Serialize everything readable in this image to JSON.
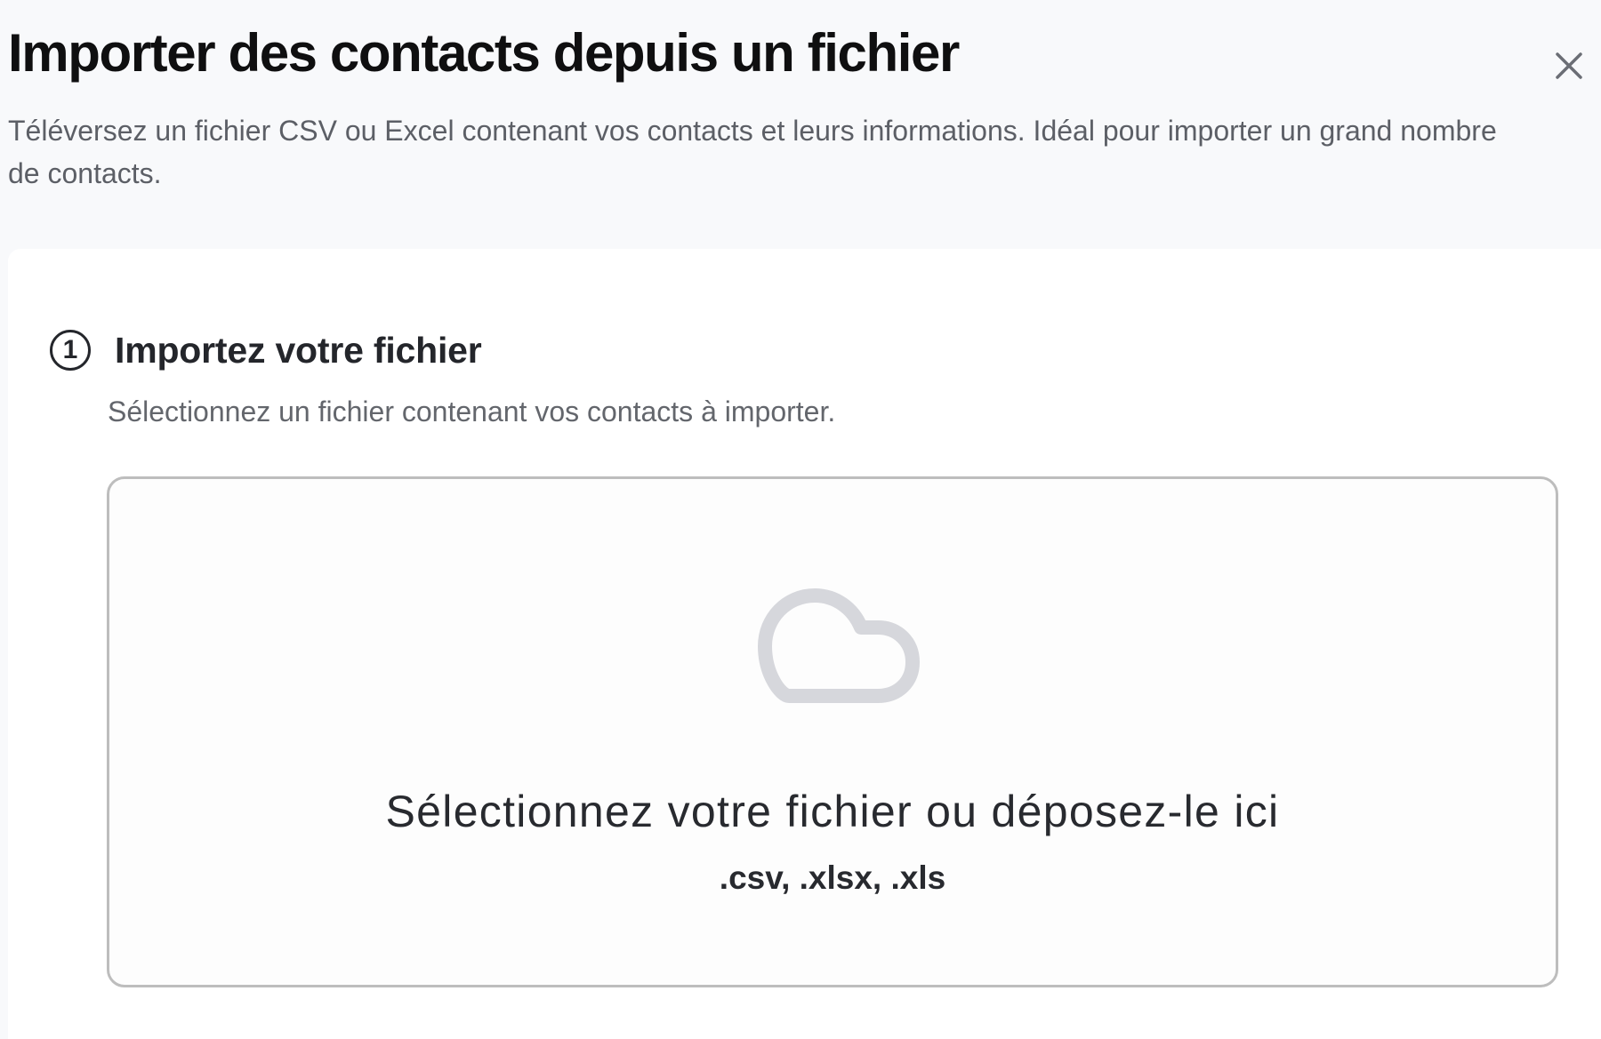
{
  "dialog": {
    "title": "Importer des contacts depuis un fichier",
    "subtitle": "Téléversez un fichier CSV ou Excel contenant vos contacts et leurs informations. Idéal pour importer un grand nombre de contacts.",
    "close_icon": "close-icon"
  },
  "step": {
    "number": "1",
    "title": "Importez votre fichier",
    "description": "Sélectionnez un fichier contenant vos contacts à importer."
  },
  "dropzone": {
    "icon": "cloud-icon",
    "title": "Sélectionnez votre fichier ou déposez-le ici",
    "formats": ".csv, .xlsx, .xls"
  },
  "colors": {
    "page_background": "#f8f9fb",
    "card_background": "#ffffff",
    "dropzone_border": "#bdbdbd",
    "cloud_icon": "#d6d7dc",
    "close_icon": "#6b6e75",
    "title_text": "#0f0f10",
    "muted_text": "#5c5f66"
  }
}
